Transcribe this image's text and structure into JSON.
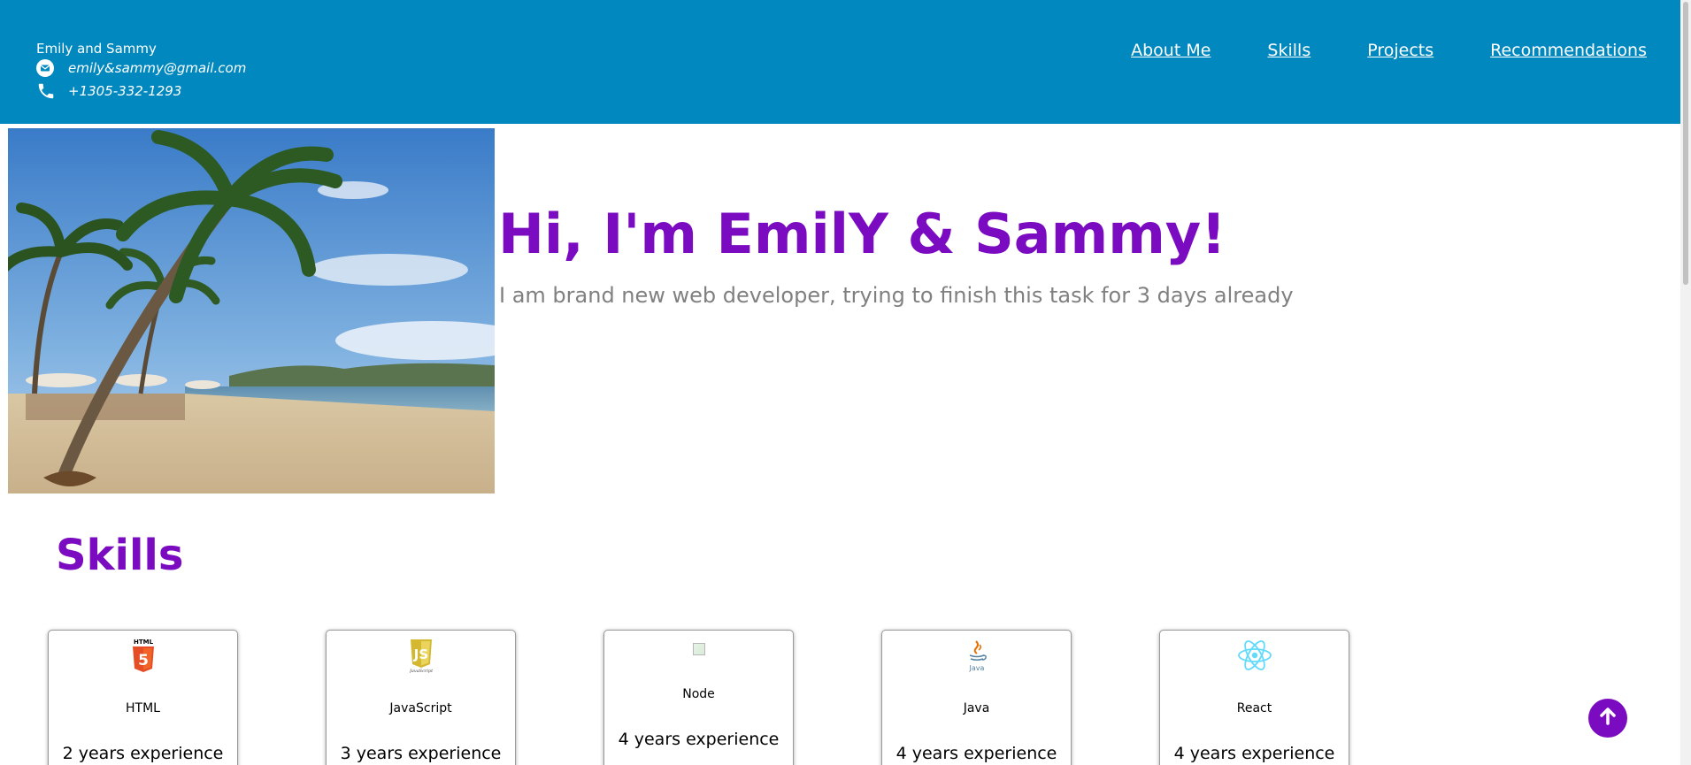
{
  "header": {
    "brand_name": "Emily and Sammy",
    "email": "emily&sammy@gmail.com",
    "phone": "+1305-332-1293",
    "email_icon": "envelope-icon",
    "phone_icon": "phone-icon",
    "nav": {
      "about": "About Me",
      "skills": "Skills",
      "projects": "Projects",
      "recommendations": "Recommendations"
    },
    "background_color": "#0088bf"
  },
  "hero": {
    "title": "Hi, I'm EmilY & Sammy!",
    "subtitle": "I am brand new web developer, trying to finish this task for 3 days already",
    "image": "beach-palm-trees-photo",
    "title_color": "#7a0bc0"
  },
  "skills": {
    "heading": "Skills",
    "items": [
      {
        "name": "HTML",
        "experience": "2 years experience",
        "icon": "html5-icon"
      },
      {
        "name": "JavaScript",
        "experience": "3 years experience",
        "icon": "javascript-icon"
      },
      {
        "name": "Node",
        "experience": "4 years experience",
        "icon": "broken-image-icon"
      },
      {
        "name": "Java",
        "experience": "4 years experience",
        "icon": "java-icon"
      },
      {
        "name": "React",
        "experience": "4 years experience",
        "icon": "react-icon"
      }
    ]
  },
  "scroll_top": {
    "icon": "arrow-up-icon"
  }
}
